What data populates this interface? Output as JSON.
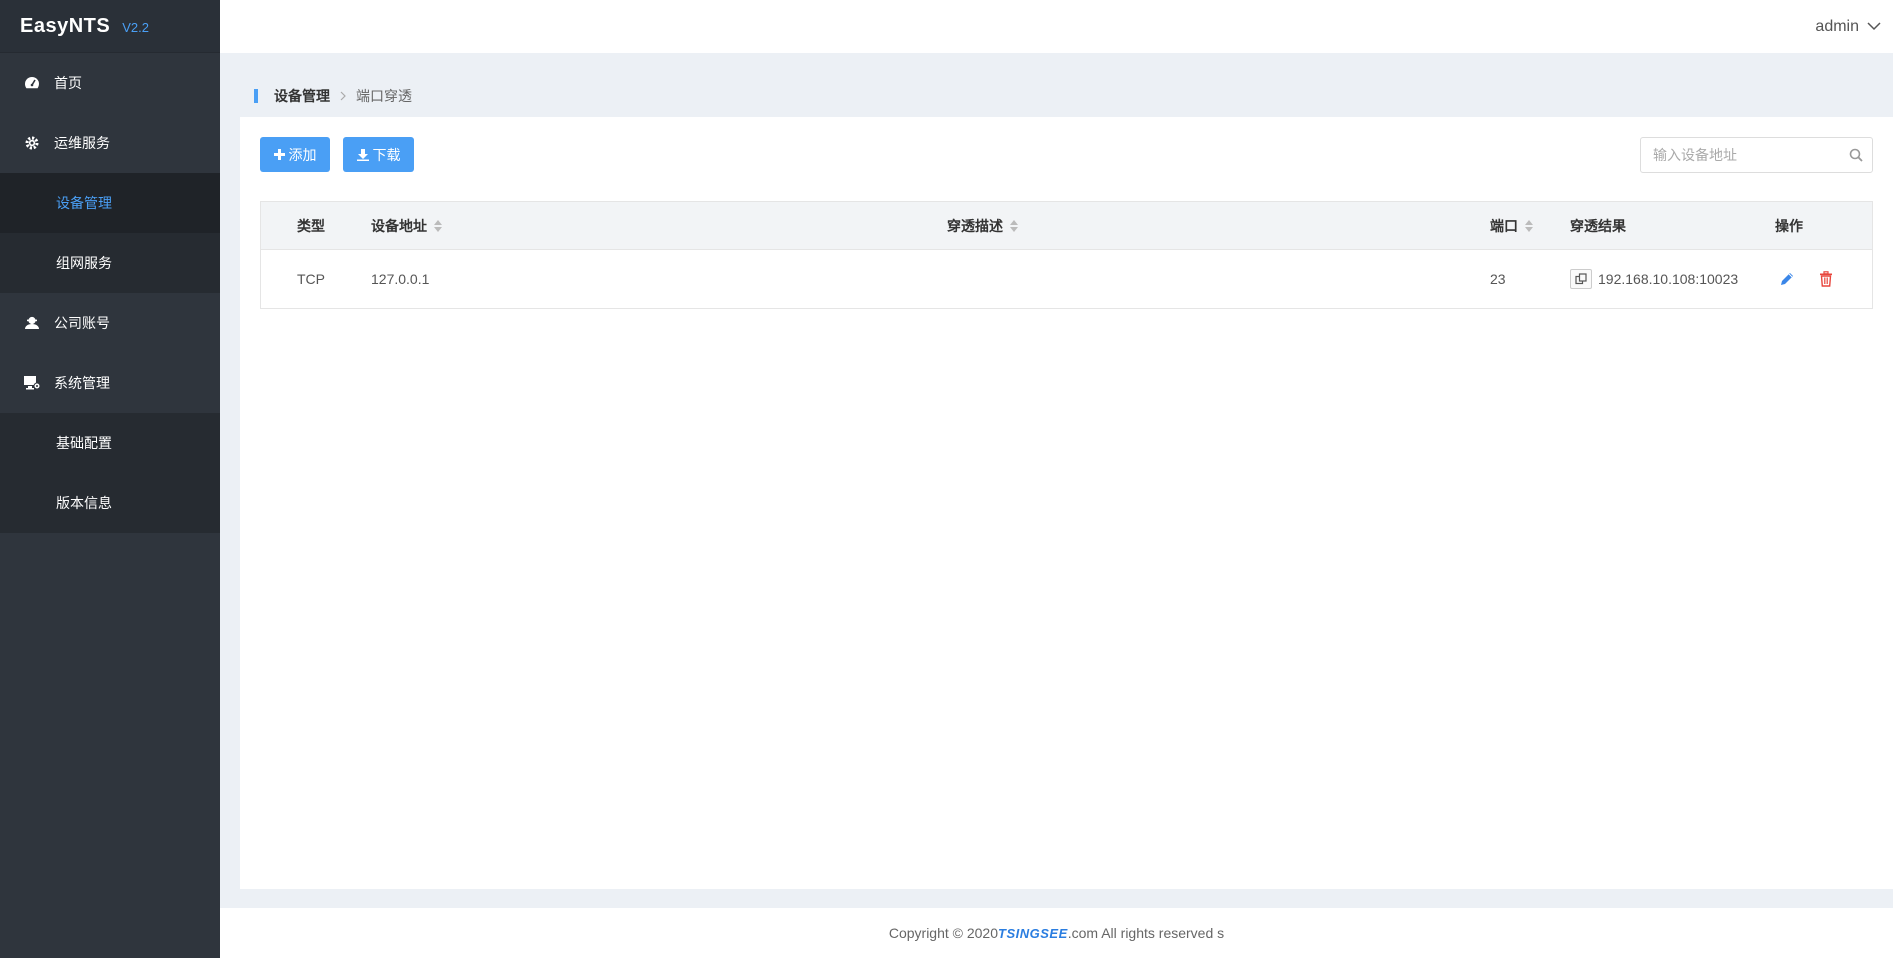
{
  "app": {
    "name": "EasyNTS",
    "version": "V2.2"
  },
  "header": {
    "user": "admin"
  },
  "sidebar": {
    "items": [
      {
        "label": "首页",
        "icon": "dashboard-icon"
      },
      {
        "label": "运维服务",
        "icon": "gear-icon",
        "children": [
          {
            "label": "设备管理",
            "active": true
          },
          {
            "label": "组网服务"
          }
        ]
      },
      {
        "label": "公司账号",
        "icon": "user-icon"
      },
      {
        "label": "系统管理",
        "icon": "system-icon",
        "children": [
          {
            "label": "基础配置"
          },
          {
            "label": "版本信息"
          }
        ]
      }
    ]
  },
  "breadcrumb": {
    "level1": "设备管理",
    "level2": "端口穿透"
  },
  "toolbar": {
    "add_label": "添加",
    "download_label": "下载",
    "search_placeholder": "输入设备地址"
  },
  "table": {
    "headers": {
      "type": "类型",
      "address": "设备地址",
      "description": "穿透描述",
      "port": "端口",
      "result": "穿透结果",
      "action": "操作"
    },
    "rows": [
      {
        "type": "TCP",
        "address": "127.0.0.1",
        "description": "",
        "port": "23",
        "result": "192.168.10.108:10023"
      }
    ]
  },
  "footer": {
    "prefix": "Copyright © 2020 ",
    "brand": "TSINGSEE",
    "suffix": ".com All rights reserved s"
  },
  "colors": {
    "accent": "#4a9ff5",
    "sidebar_bg": "#2f353d",
    "delete": "#e8453c"
  }
}
